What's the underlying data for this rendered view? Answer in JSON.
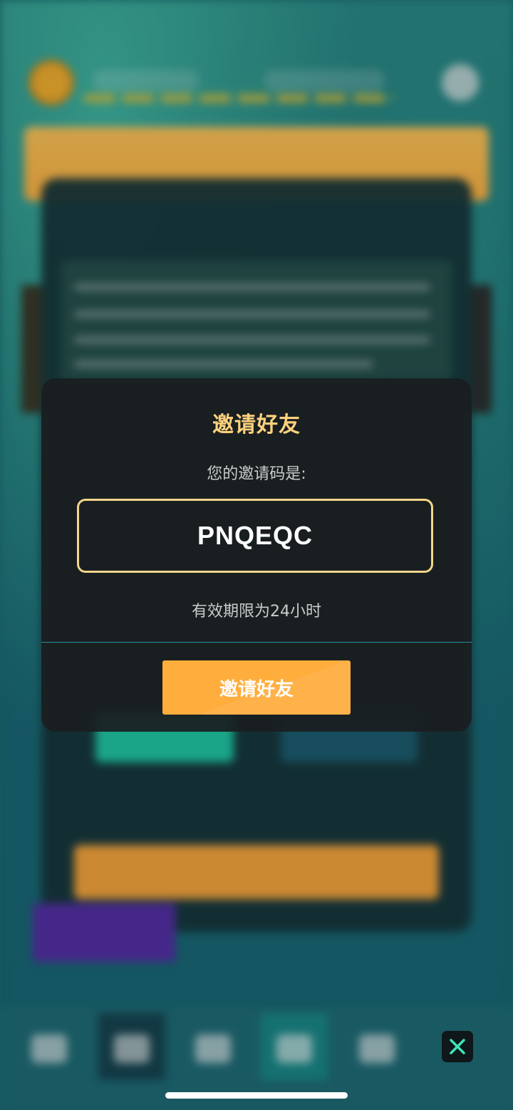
{
  "modal": {
    "title": "邀请好友",
    "code_label": "您的邀请码是:",
    "invite_code": "PNQEQC",
    "validity_text": "有效期限为24小时",
    "invite_button_label": "邀请好友"
  },
  "icons": {
    "close": "close-icon"
  },
  "colors": {
    "title_accent": "#ffd27d",
    "code_border": "#f4d58a",
    "button_orange": "#ffae3d",
    "close_x": "#3fe3b8"
  }
}
